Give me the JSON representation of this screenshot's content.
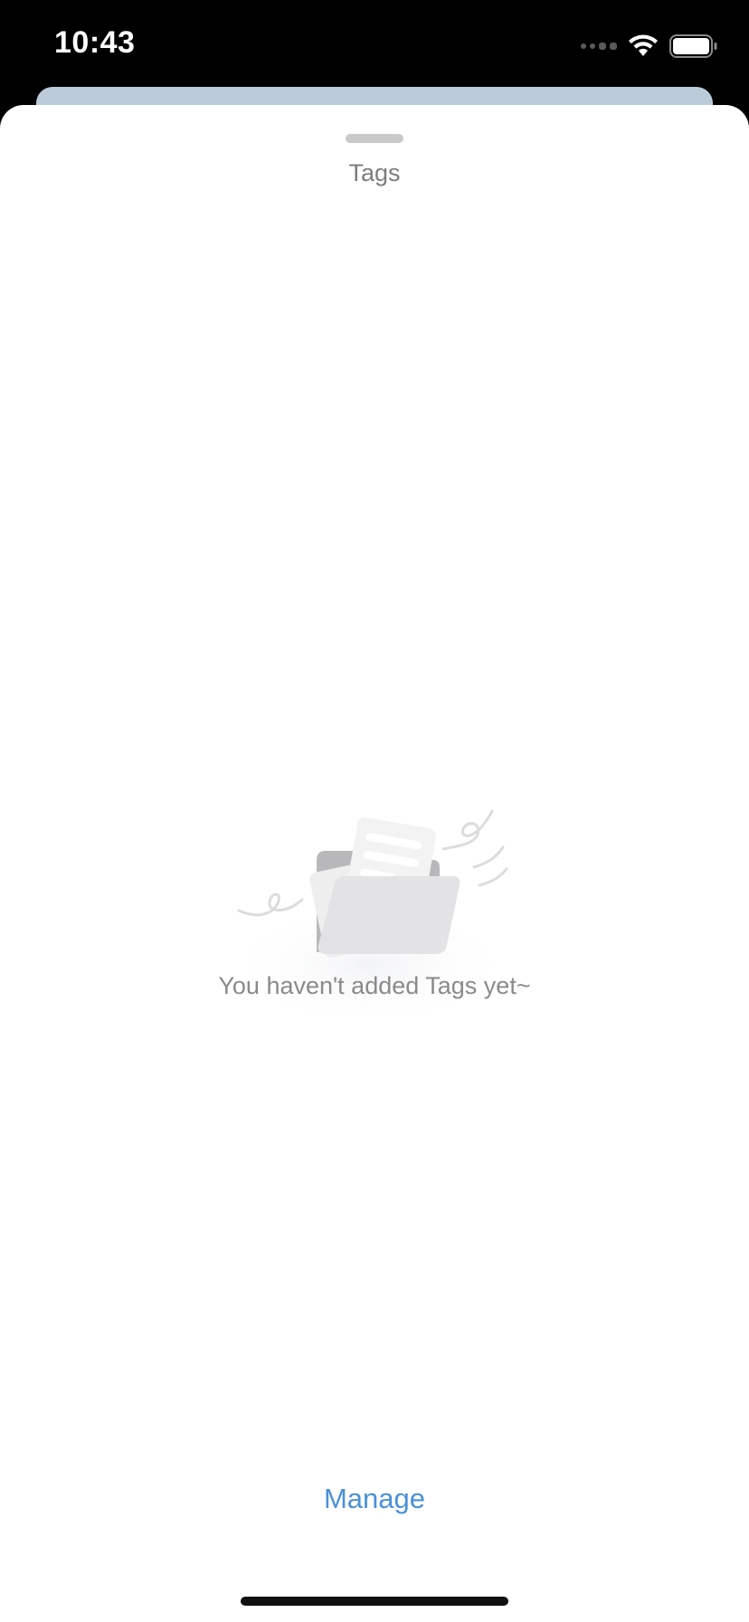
{
  "status_bar": {
    "time": "10:43",
    "icons": [
      "signal-icon",
      "wifi-icon",
      "battery-icon"
    ]
  },
  "sheet": {
    "title": "Tags",
    "empty_state": {
      "illustration": "empty-folder-illustration",
      "message": "You haven't added Tags yet~"
    },
    "manage_label": "Manage"
  },
  "colors": {
    "accent": "#4a90d9",
    "title_text": "#7d7d7d",
    "background_card": "#bccbd9"
  }
}
